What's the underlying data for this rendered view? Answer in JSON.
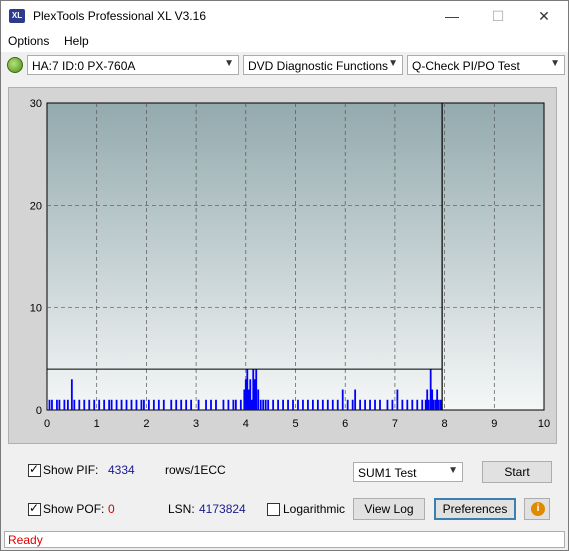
{
  "window": {
    "title": "PlexTools Professional XL V3.16",
    "icon_text": "XL"
  },
  "titlebar_buttons": {
    "minimize": "—",
    "maximize": "☐",
    "close": "✕"
  },
  "menu": {
    "items": [
      {
        "label": "Options"
      },
      {
        "label": "Help"
      }
    ]
  },
  "toolbar": {
    "drive": "HA:7 ID:0  PX-760A",
    "function": "DVD Diagnostic Functions",
    "test": "Q-Check PI/PO Test"
  },
  "chart_data": {
    "type": "bar",
    "x_ticks": [
      "0",
      "1",
      "2",
      "3",
      "4",
      "5",
      "6",
      "7",
      "8",
      "9",
      "10"
    ],
    "y_ticks": [
      "0",
      "10",
      "20",
      "30"
    ],
    "xlim": [
      0,
      10
    ],
    "ylim": [
      0,
      30
    ],
    "threshold_y": 4,
    "cursor_x": 7.95,
    "grid": true,
    "bar_color": "#0000ff",
    "series": [
      {
        "values": [
          [
            0.05,
            1
          ],
          [
            0.1,
            1
          ],
          [
            0.2,
            1
          ],
          [
            0.25,
            1
          ],
          [
            0.35,
            1
          ],
          [
            0.42,
            1
          ],
          [
            0.5,
            3
          ],
          [
            0.55,
            1
          ],
          [
            0.65,
            1
          ],
          [
            0.75,
            1
          ],
          [
            0.85,
            1
          ],
          [
            0.95,
            1
          ],
          [
            1.05,
            1
          ],
          [
            1.15,
            1
          ],
          [
            1.25,
            1
          ],
          [
            1.3,
            1
          ],
          [
            1.4,
            1
          ],
          [
            1.5,
            1
          ],
          [
            1.6,
            1
          ],
          [
            1.7,
            1
          ],
          [
            1.8,
            1
          ],
          [
            1.9,
            1
          ],
          [
            1.95,
            1
          ],
          [
            2.05,
            1
          ],
          [
            2.15,
            1
          ],
          [
            2.25,
            1
          ],
          [
            2.35,
            1
          ],
          [
            2.5,
            1
          ],
          [
            2.6,
            1
          ],
          [
            2.7,
            1
          ],
          [
            2.8,
            1
          ],
          [
            2.9,
            1
          ],
          [
            3.05,
            1
          ],
          [
            3.2,
            1
          ],
          [
            3.3,
            1
          ],
          [
            3.4,
            1
          ],
          [
            3.55,
            1
          ],
          [
            3.65,
            1
          ],
          [
            3.75,
            1
          ],
          [
            3.8,
            1
          ],
          [
            3.9,
            1
          ],
          [
            3.97,
            2
          ],
          [
            4.0,
            3
          ],
          [
            4.03,
            4
          ],
          [
            4.06,
            2
          ],
          [
            4.09,
            3
          ],
          [
            4.12,
            1
          ],
          [
            4.15,
            4
          ],
          [
            4.18,
            3
          ],
          [
            4.21,
            4
          ],
          [
            4.25,
            2
          ],
          [
            4.3,
            1
          ],
          [
            4.35,
            1
          ],
          [
            4.4,
            1
          ],
          [
            4.45,
            1
          ],
          [
            4.55,
            1
          ],
          [
            4.65,
            1
          ],
          [
            4.75,
            1
          ],
          [
            4.85,
            1
          ],
          [
            4.95,
            1
          ],
          [
            5.05,
            1
          ],
          [
            5.15,
            1
          ],
          [
            5.25,
            1
          ],
          [
            5.35,
            1
          ],
          [
            5.45,
            1
          ],
          [
            5.55,
            1
          ],
          [
            5.65,
            1
          ],
          [
            5.75,
            1
          ],
          [
            5.85,
            1
          ],
          [
            5.95,
            2
          ],
          [
            6.05,
            1
          ],
          [
            6.15,
            1
          ],
          [
            6.2,
            2
          ],
          [
            6.3,
            1
          ],
          [
            6.4,
            1
          ],
          [
            6.5,
            1
          ],
          [
            6.6,
            1
          ],
          [
            6.7,
            1
          ],
          [
            6.85,
            1
          ],
          [
            6.95,
            1
          ],
          [
            7.05,
            2
          ],
          [
            7.15,
            1
          ],
          [
            7.25,
            1
          ],
          [
            7.35,
            1
          ],
          [
            7.45,
            1
          ],
          [
            7.55,
            1
          ],
          [
            7.62,
            1
          ],
          [
            7.65,
            2
          ],
          [
            7.68,
            1
          ],
          [
            7.72,
            4
          ],
          [
            7.75,
            2
          ],
          [
            7.78,
            1
          ],
          [
            7.82,
            1
          ],
          [
            7.85,
            2
          ],
          [
            7.88,
            1
          ],
          [
            7.92,
            1
          ]
        ]
      }
    ]
  },
  "controls": {
    "show_pif": {
      "label": "Show PIF:",
      "checked": true
    },
    "pif_value": "4334",
    "rows_unit": "rows/1ECC",
    "show_pof": {
      "label": "Show POF:",
      "checked": true
    },
    "pof_value": "0",
    "lsn_label": "LSN:",
    "lsn_value": "4173824",
    "logarithmic": {
      "label": "Logarithmic",
      "checked": false
    },
    "sum_test": "SUM1 Test",
    "start": "Start",
    "view_log": "View Log",
    "preferences": "Preferences",
    "info": "i"
  },
  "colors": {
    "pif_value": "#1a1a8c",
    "pof_value": "#cc0000",
    "status": "#e00000"
  },
  "status": {
    "text": "Ready"
  }
}
